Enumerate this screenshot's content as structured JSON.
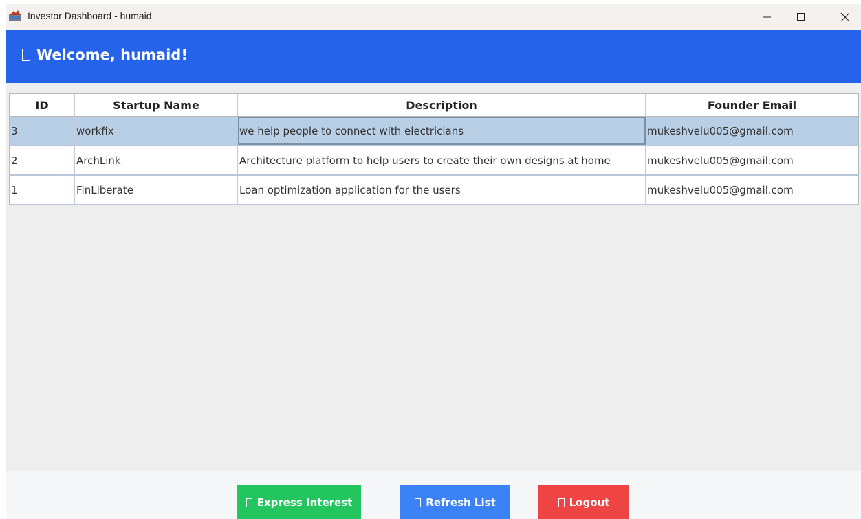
{
  "window": {
    "title": "Investor Dashboard - humaid"
  },
  "header": {
    "title": "Welcome, humaid!",
    "background": "#2563eb"
  },
  "table": {
    "columns": [
      "ID",
      "Startup Name",
      "Description",
      "Founder Email"
    ],
    "rows": [
      {
        "id": "3",
        "name": "workfix",
        "description": "we help people to connect with electricians",
        "email": "mukeshvelu005@gmail.com",
        "selected": true
      },
      {
        "id": "2",
        "name": "ArchLink",
        "description": "Architecture platform to help users to create their own designs at home",
        "email": "mukeshvelu005@gmail.com",
        "selected": false
      },
      {
        "id": "1",
        "name": "FinLiberate",
        "description": "Loan optimization application for the users",
        "email": "mukeshvelu005@gmail.com",
        "selected": false
      }
    ]
  },
  "footer": {
    "express_interest_label": "Express Interest",
    "refresh_label": "Refresh List",
    "logout_label": "Logout",
    "colors": {
      "express_interest": "#22c55e",
      "refresh": "#3b82f6",
      "logout": "#ef4444"
    }
  }
}
